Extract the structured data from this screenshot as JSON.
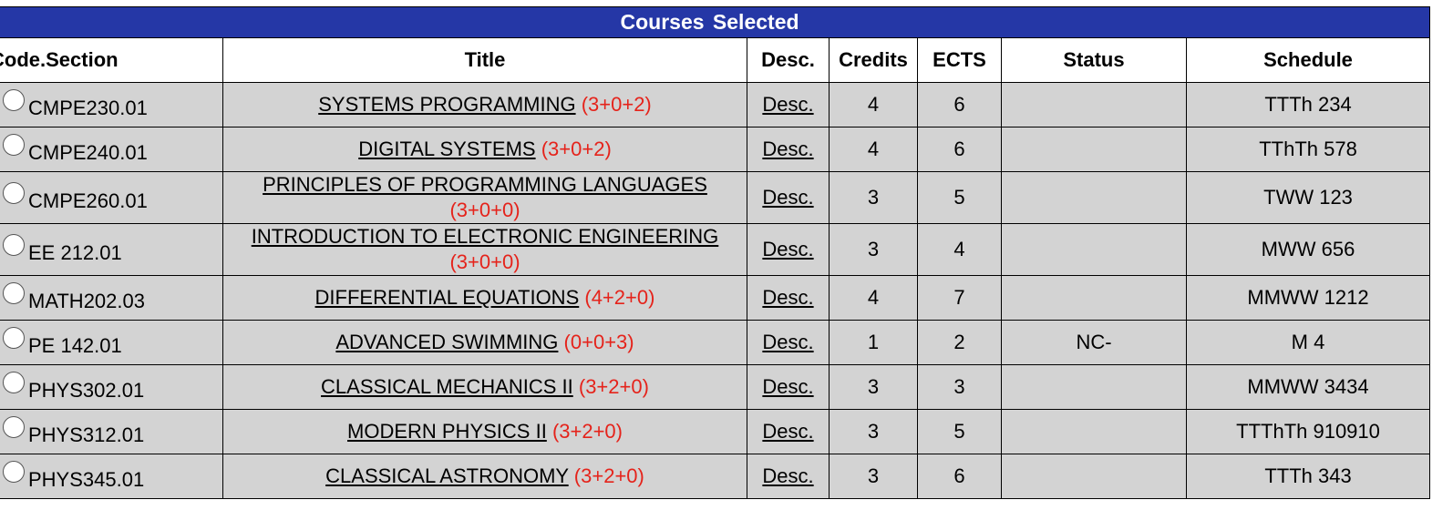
{
  "table": {
    "banner": "Courses  Selected",
    "headers": {
      "code": "Code.Section",
      "title": "Title",
      "desc": "Desc.",
      "credits": "Credits",
      "ects": "ECTS",
      "status": "Status",
      "schedule": "Schedule"
    },
    "rows": [
      {
        "code": "CMPE230.01",
        "title": "SYSTEMS PROGRAMMING",
        "hours": "(3+0+2)",
        "desc": "Desc.",
        "credits": "4",
        "ects": "6",
        "status": "",
        "schedule": "TTTh 234"
      },
      {
        "code": "CMPE240.01",
        "title": "DIGITAL SYSTEMS",
        "hours": "(3+0+2)",
        "desc": "Desc.",
        "credits": "4",
        "ects": "6",
        "status": "",
        "schedule": "TThTh 578"
      },
      {
        "code": "CMPE260.01",
        "title": "PRINCIPLES OF PROGRAMMING LANGUAGES",
        "hours": "(3+0+0)",
        "desc": "Desc.",
        "credits": "3",
        "ects": "5",
        "status": "",
        "schedule": "TWW 123"
      },
      {
        "code": "EE 212.01",
        "title": "INTRODUCTION TO ELECTRONIC ENGINEERING",
        "hours": "(3+0+0)",
        "desc": "Desc.",
        "credits": "3",
        "ects": "4",
        "status": "",
        "schedule": "MWW 656"
      },
      {
        "code": "MATH202.03",
        "title": "DIFFERENTIAL EQUATIONS",
        "hours": "(4+2+0)",
        "desc": "Desc.",
        "credits": "4",
        "ects": "7",
        "status": "",
        "schedule": "MMWW 1212"
      },
      {
        "code": "PE 142.01",
        "title": "ADVANCED SWIMMING",
        "hours": "(0+0+3)",
        "desc": "Desc.",
        "credits": "1",
        "ects": "2",
        "status": "NC-",
        "schedule": "M 4"
      },
      {
        "code": "PHYS302.01",
        "title": "CLASSICAL MECHANICS II",
        "hours": "(3+2+0)",
        "desc": "Desc.",
        "credits": "3",
        "ects": "3",
        "status": "",
        "schedule": "MMWW 3434"
      },
      {
        "code": "PHYS312.01",
        "title": "MODERN PHYSICS II",
        "hours": "(3+2+0)",
        "desc": "Desc.",
        "credits": "3",
        "ects": "5",
        "status": "",
        "schedule": "TTThTh 910910"
      },
      {
        "code": "PHYS345.01",
        "title": "CLASSICAL ASTRONOMY",
        "hours": "(3+2+0)",
        "desc": "Desc.",
        "credits": "3",
        "ects": "6",
        "status": "",
        "schedule": "TTTh 343"
      }
    ]
  }
}
